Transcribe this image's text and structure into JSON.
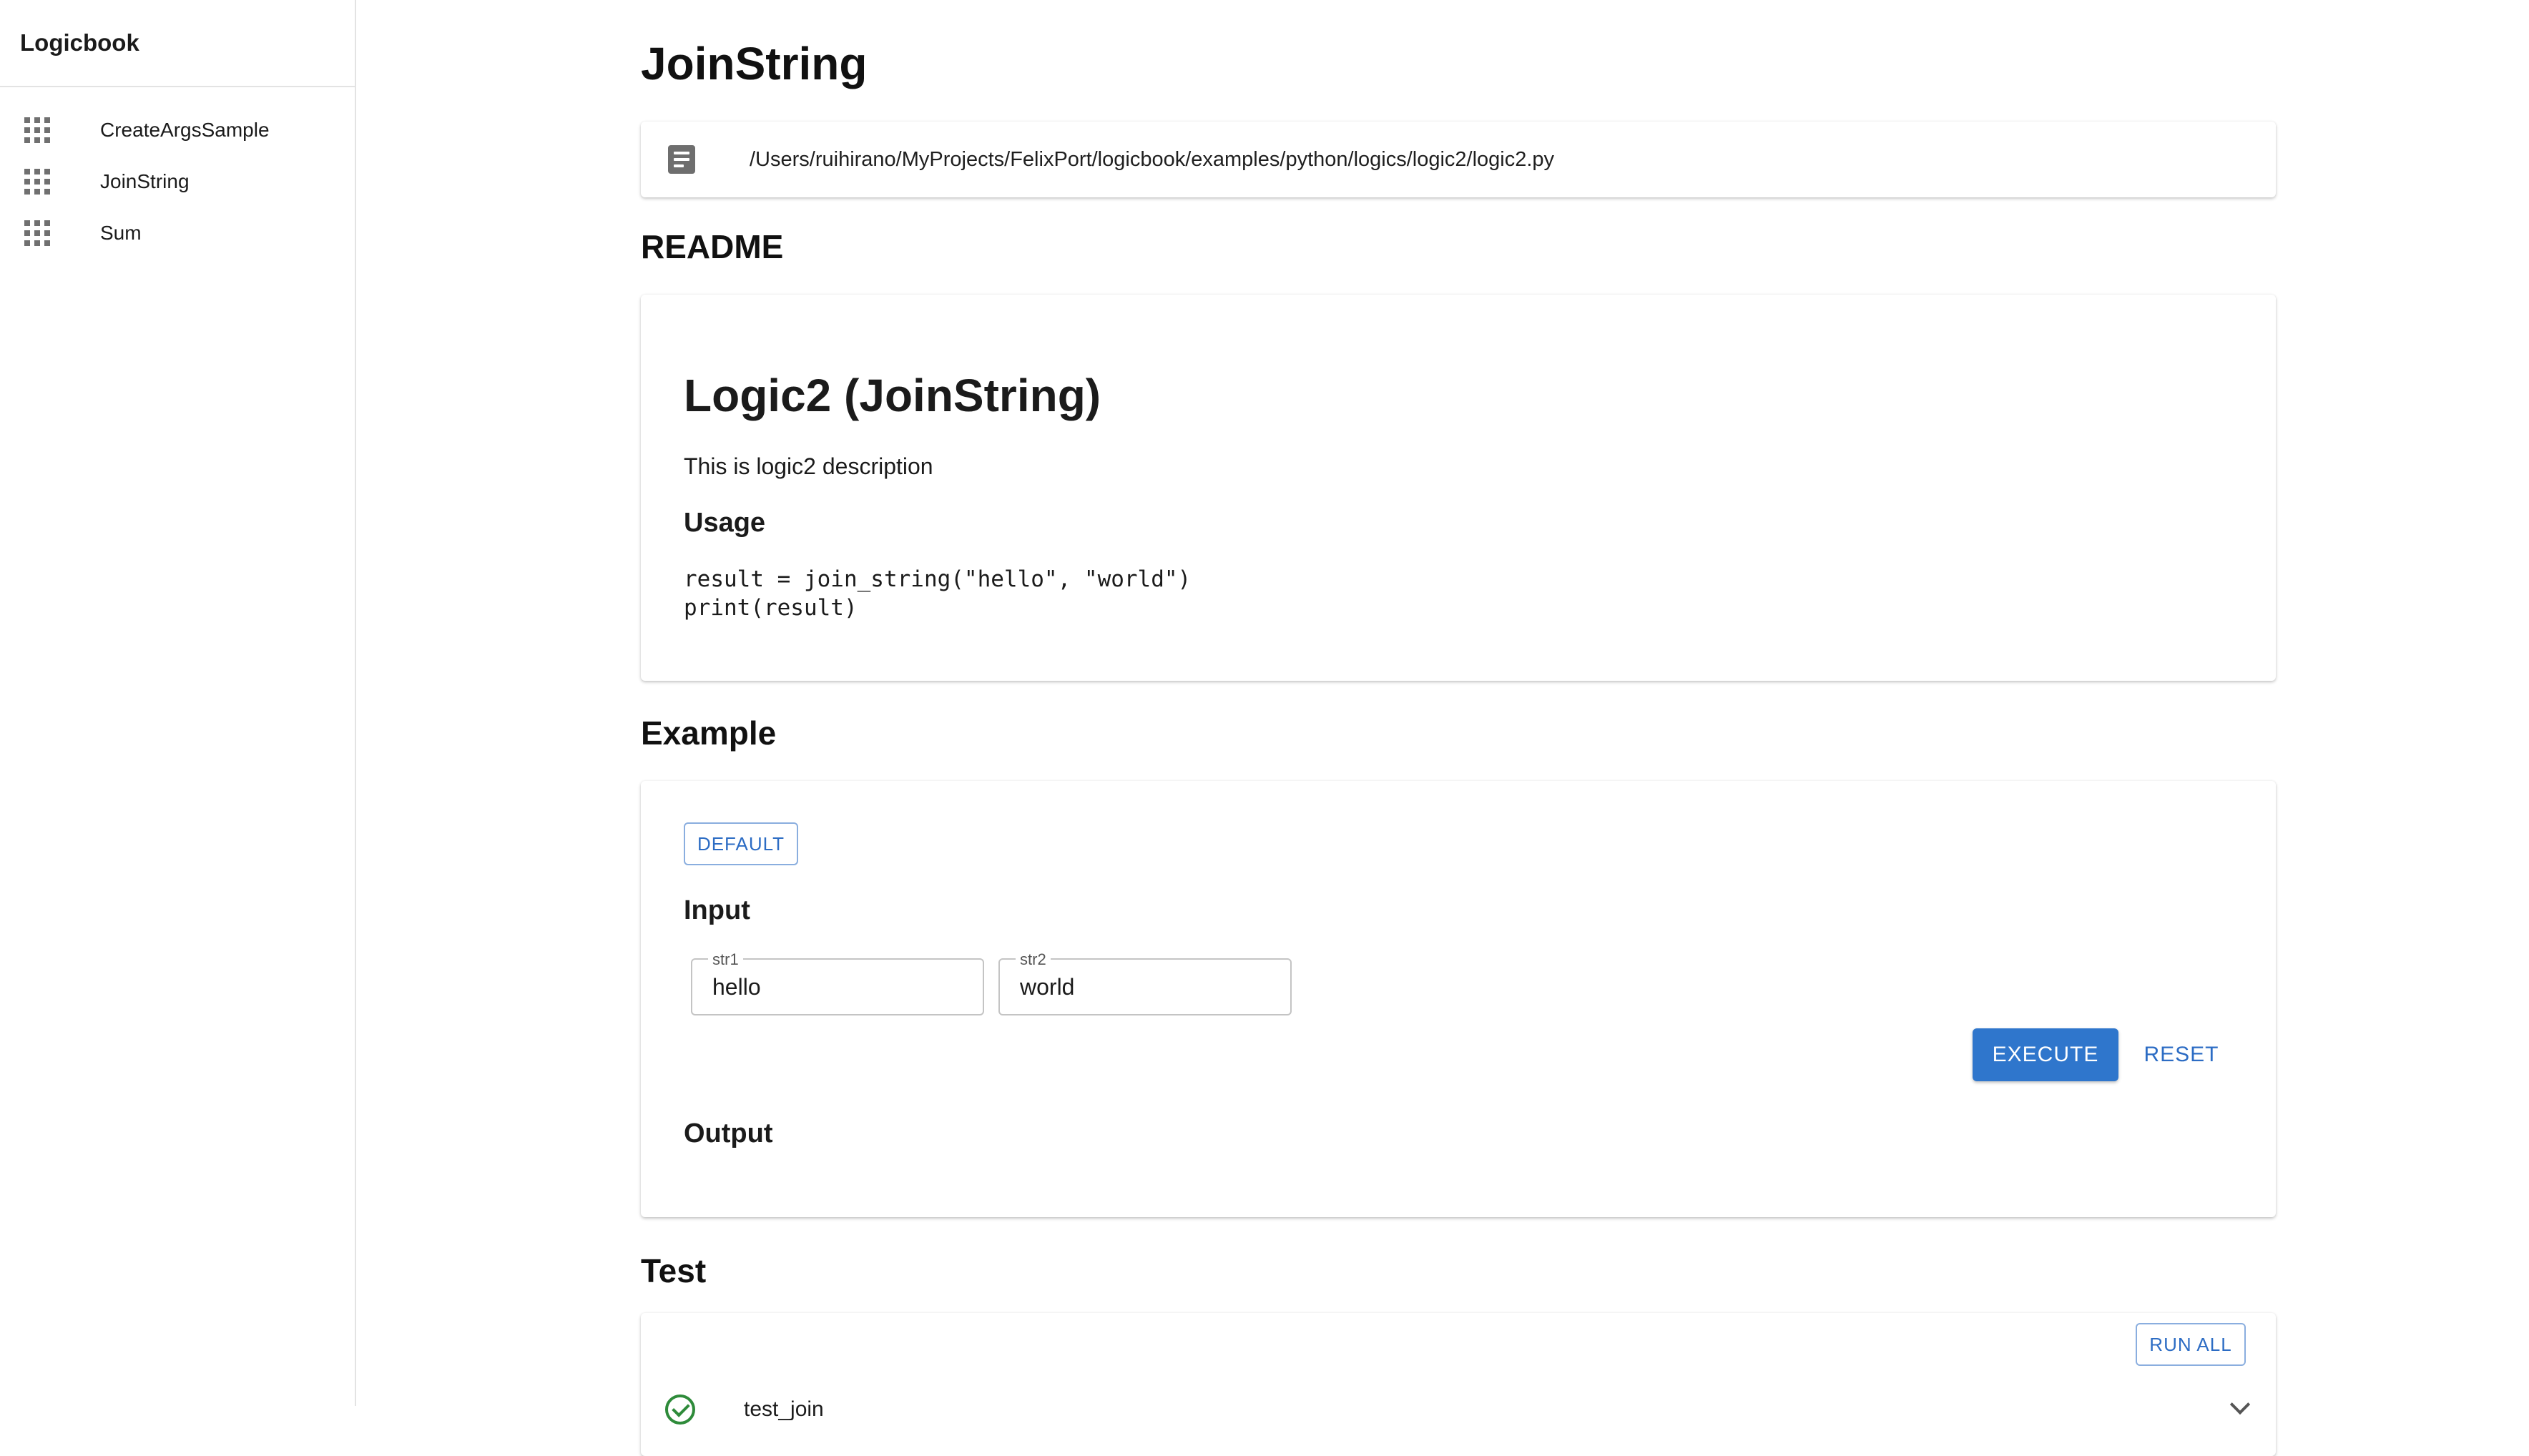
{
  "app": {
    "title": "Logicbook"
  },
  "sidebar": {
    "items": [
      {
        "label": "CreateArgsSample",
        "icon": "apps-grid-icon"
      },
      {
        "label": "JoinString",
        "icon": "apps-grid-icon"
      },
      {
        "label": "Sum",
        "icon": "apps-grid-icon"
      }
    ]
  },
  "page": {
    "title": "JoinString",
    "file_path": "/Users/ruihirano/MyProjects/FelixPort/logicbook/examples/python/logics/logic2/logic2.py"
  },
  "readme": {
    "section_title": "README",
    "heading": "Logic2 (JoinString)",
    "description": "This is logic2 description",
    "usage_heading": "Usage",
    "code": "result = join_string(\"hello\", \"world\")\nprint(result)"
  },
  "example": {
    "section_title": "Example",
    "default_label": "DEFAULT",
    "input_heading": "Input",
    "fields": [
      {
        "label": "str1",
        "value": "hello"
      },
      {
        "label": "str2",
        "value": "world"
      }
    ],
    "execute_label": "EXECUTE",
    "reset_label": "RESET",
    "output_heading": "Output"
  },
  "test": {
    "section_title": "Test",
    "run_all_label": "RUN ALL",
    "items": [
      {
        "name": "test_join",
        "status": "passed"
      }
    ]
  },
  "colors": {
    "accent": "#2f76cc",
    "success": "#2e8b3a"
  }
}
